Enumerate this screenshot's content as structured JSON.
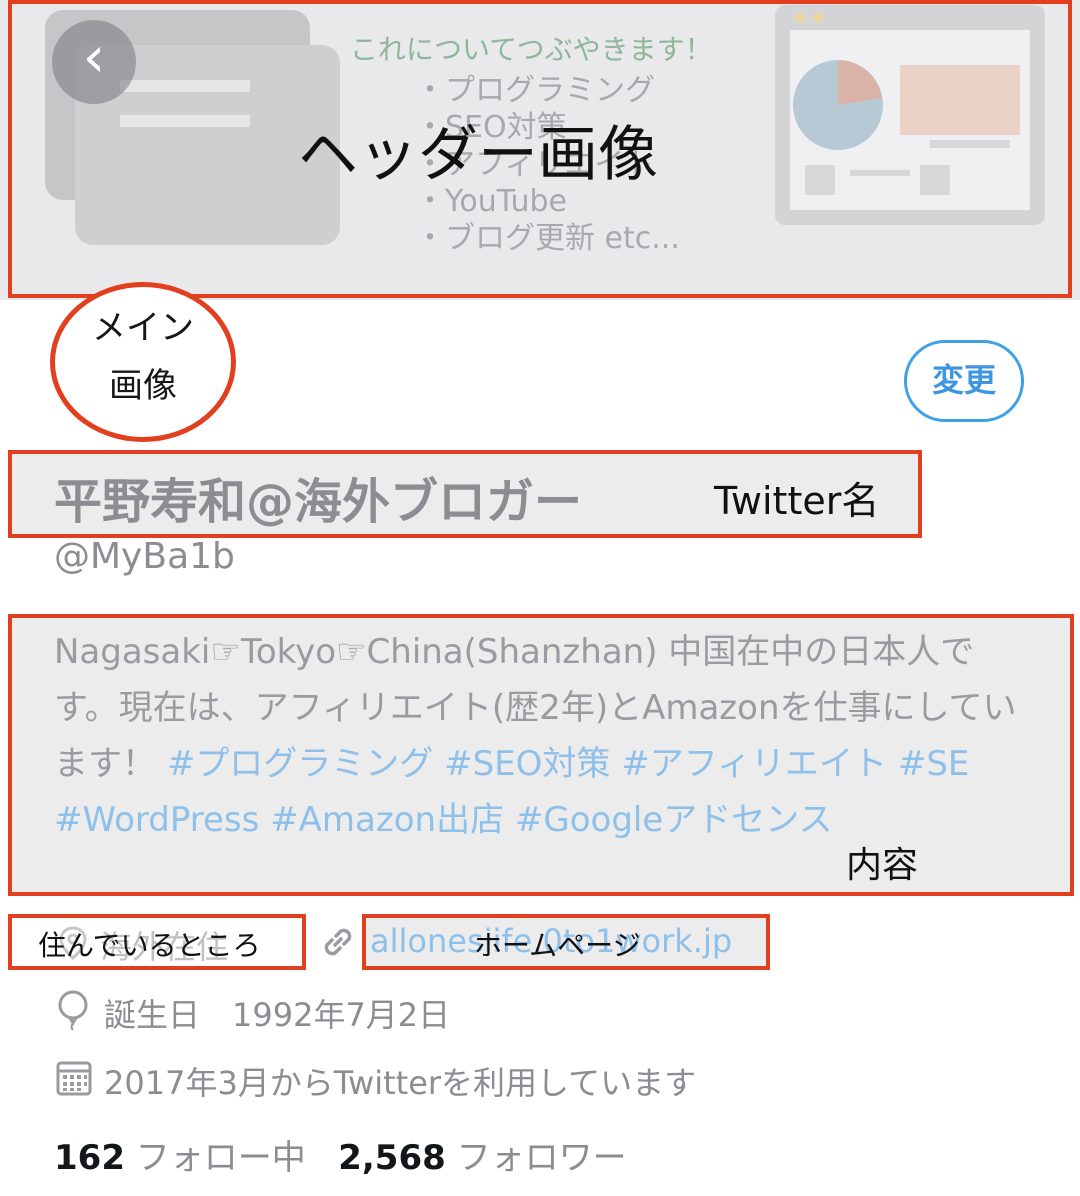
{
  "header": {
    "art_title": "これについてつぶやきます！",
    "art_items": [
      "・プログラミング",
      "・SEO対策",
      "・アフィリエイト",
      "・YouTube",
      "・ブログ更新 etc..."
    ]
  },
  "back_icon": "‹",
  "profile": {
    "name": "平野寿和@海外ブロガー",
    "handle": "@MyBa1b",
    "bio_text": "Nagasaki☞Tokyo☞China(Shanzhan) 中国在中の日本人です。現在は、アフィリエイト(歴2年)とAmazonを仕事にしています！ ",
    "bio_tags": "#プログラミング #SEO対策 #アフィリエイト #SE #WordPress #Amazon出店 #Googleアドセンス",
    "location": "海外在住",
    "website": "allonesiife.0to1work.jp",
    "birthday": "誕生日　1992年7月2日",
    "joined": "2017年3月からTwitterを利用しています",
    "following_count": "162",
    "following_label": "フォロー中",
    "followers_count": "2,568",
    "followers_label": "フォロワー"
  },
  "edit_button": "変更",
  "annotations": {
    "header": "ヘッダー画像",
    "main_image": [
      "メイン",
      "画像"
    ],
    "twitter_name": "Twitter名",
    "content": "内容",
    "location": "住んでいるところ",
    "homepage": "ホームページ"
  },
  "colors": {
    "annotation_red": "#e23f1f",
    "accent_blue": "#3f96e0",
    "muted_text": "#8c8c92"
  },
  "icons": [
    "back-icon",
    "location-icon",
    "link-icon",
    "balloon-icon",
    "calendar-icon"
  ]
}
